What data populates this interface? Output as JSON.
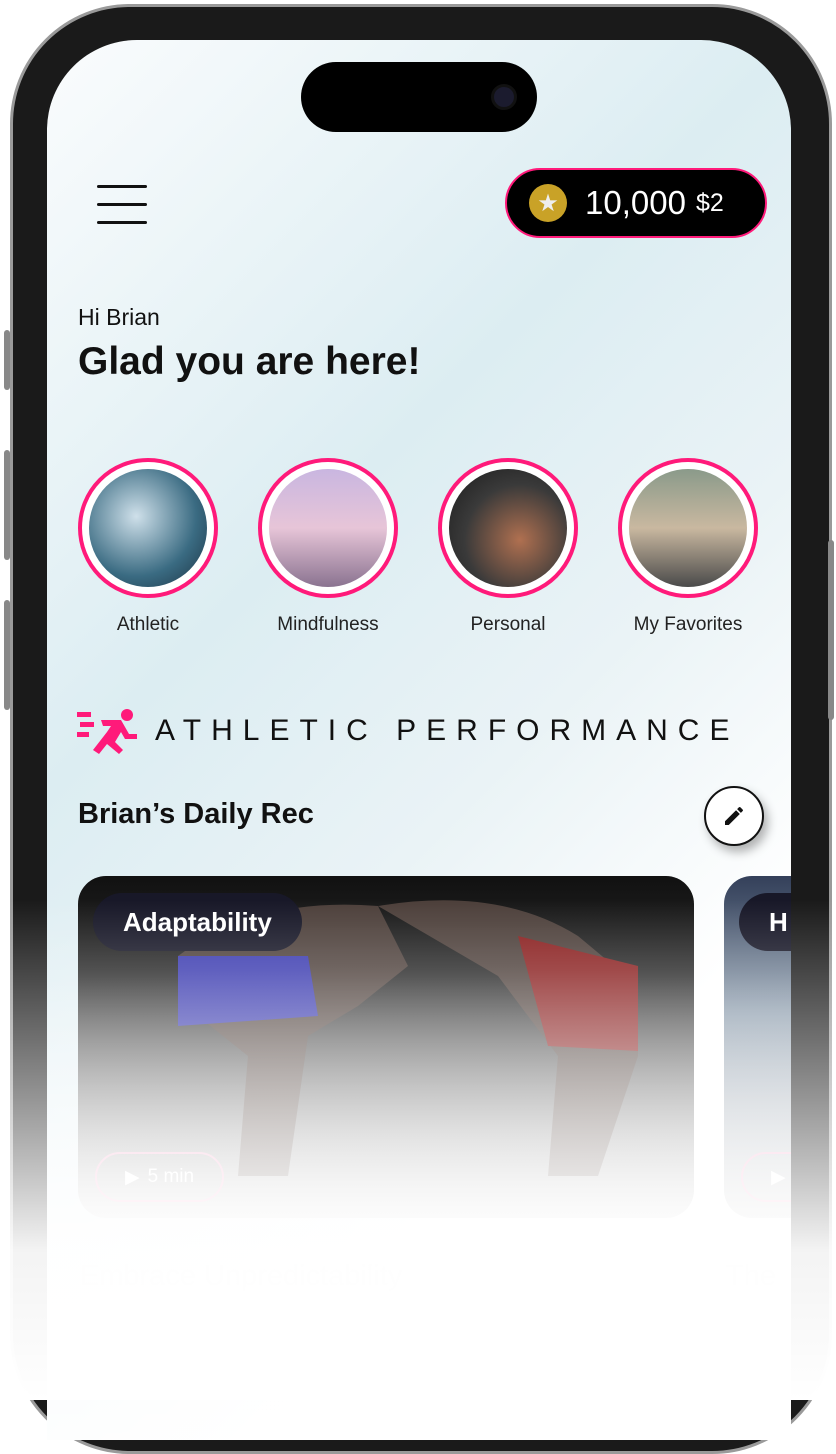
{
  "header": {
    "menu_icon": "hamburger-icon",
    "coin_icon": "star-coin-icon",
    "coins": "10,000",
    "cash": "$2",
    "accent": "#ff1a7a"
  },
  "greeting": {
    "hi": "Hi Brian",
    "headline": "Glad you are here!"
  },
  "categories": [
    {
      "label": "Athletic"
    },
    {
      "label": "Mindfulness"
    },
    {
      "label": "Personal"
    },
    {
      "label": "My Favorites"
    }
  ],
  "section": {
    "icon": "running-person-icon",
    "title": "ATHLETIC PERFORMANCE",
    "subtitle": "Brian’s Daily Rec",
    "edit_icon": "pencil-icon"
  },
  "cards": [
    {
      "tag": "Adaptability",
      "duration": "5 min",
      "title": "Embrace Unpredictability"
    },
    {
      "tag": "H",
      "duration": "",
      "title": "The"
    }
  ]
}
